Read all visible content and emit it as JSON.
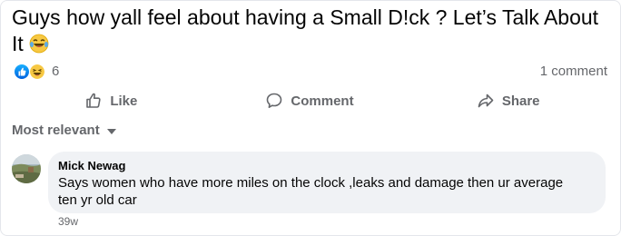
{
  "post": {
    "text": "Guys how yall feel about having a Small D!ck ? Let’s Talk About It",
    "emoji": "laughing-crying-emoji"
  },
  "reactions": {
    "icons": [
      "like-reaction-icon",
      "haha-reaction-icon"
    ],
    "count": "6",
    "comment_count": "1 comment"
  },
  "actions": {
    "like_label": "Like",
    "comment_label": "Comment",
    "share_label": "Share"
  },
  "sort": {
    "label": "Most relevant"
  },
  "comment": {
    "author": "Mick Newag",
    "text": "Says women who have more miles on the clock ,leaks and damage then ur average ten yr old car",
    "timestamp": "39w"
  },
  "colors": {
    "secondary_text": "#65676b",
    "bubble_bg": "#f0f2f5",
    "like_blue": "#1877f2",
    "haha_yellow": "#f7c843"
  }
}
